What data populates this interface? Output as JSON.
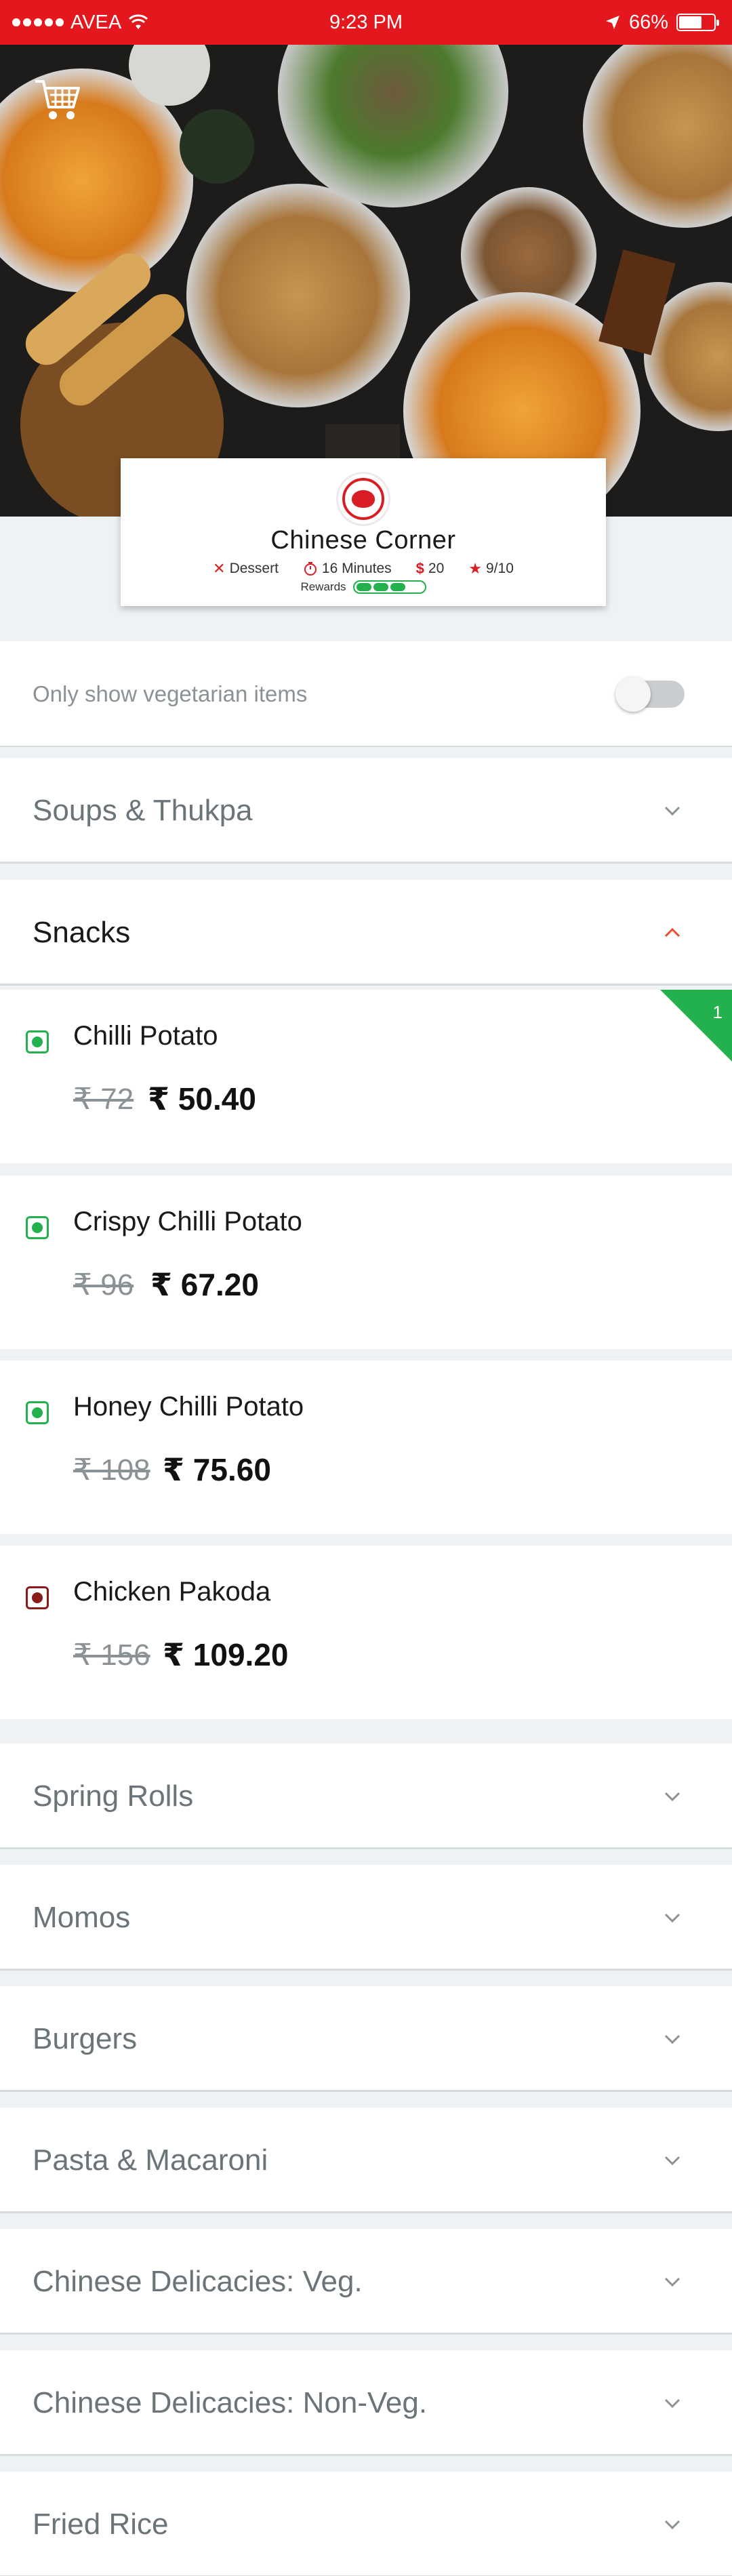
{
  "status_bar": {
    "carrier": "AVEA",
    "time": "9:23 PM",
    "battery": "66%",
    "battery_level": 0.66
  },
  "hero": {
    "cart_icon": "shopping-cart-icon"
  },
  "restaurant": {
    "name": "Chinese Corner",
    "cuisine": "Dessert",
    "delivery_time": "16 Minutes",
    "min_order": "20",
    "rating": "9/10",
    "rewards_label": "Rewards",
    "rewards_progress": 3
  },
  "veg_filter": {
    "label": "Only show vegetarian items",
    "enabled": false
  },
  "categories": [
    {
      "label": "Soups & Thukpa",
      "expanded": false
    },
    {
      "label": "Snacks",
      "expanded": true
    },
    {
      "label": "Spring Rolls",
      "expanded": false
    },
    {
      "label": "Momos",
      "expanded": false
    },
    {
      "label": "Burgers",
      "expanded": false
    },
    {
      "label": "Pasta & Macaroni",
      "expanded": false
    },
    {
      "label": "Chinese Delicacies: Veg.",
      "expanded": false
    },
    {
      "label": "Chinese Delicacies: Non-Veg.",
      "expanded": false
    },
    {
      "label": "Fried Rice",
      "expanded": false
    }
  ],
  "snacks": [
    {
      "name": "Chilli Potato",
      "old_price": "₹ 72",
      "new_price": "₹ 50.40",
      "veg": true,
      "quantity": "1"
    },
    {
      "name": "Crispy Chilli Potato",
      "old_price": "₹ 96",
      "new_price": "₹ 67.20",
      "veg": true
    },
    {
      "name": "Honey Chilli Potato",
      "old_price": "₹ 108",
      "new_price": "₹ 75.60",
      "veg": true
    },
    {
      "name": "Chicken Pakoda",
      "old_price": "₹ 156",
      "new_price": "₹ 109.20",
      "veg": false
    }
  ],
  "colors": {
    "brand_red": "#e3171d",
    "veg_green": "#22b14c",
    "nonveg_maroon": "#8b1a1a"
  }
}
